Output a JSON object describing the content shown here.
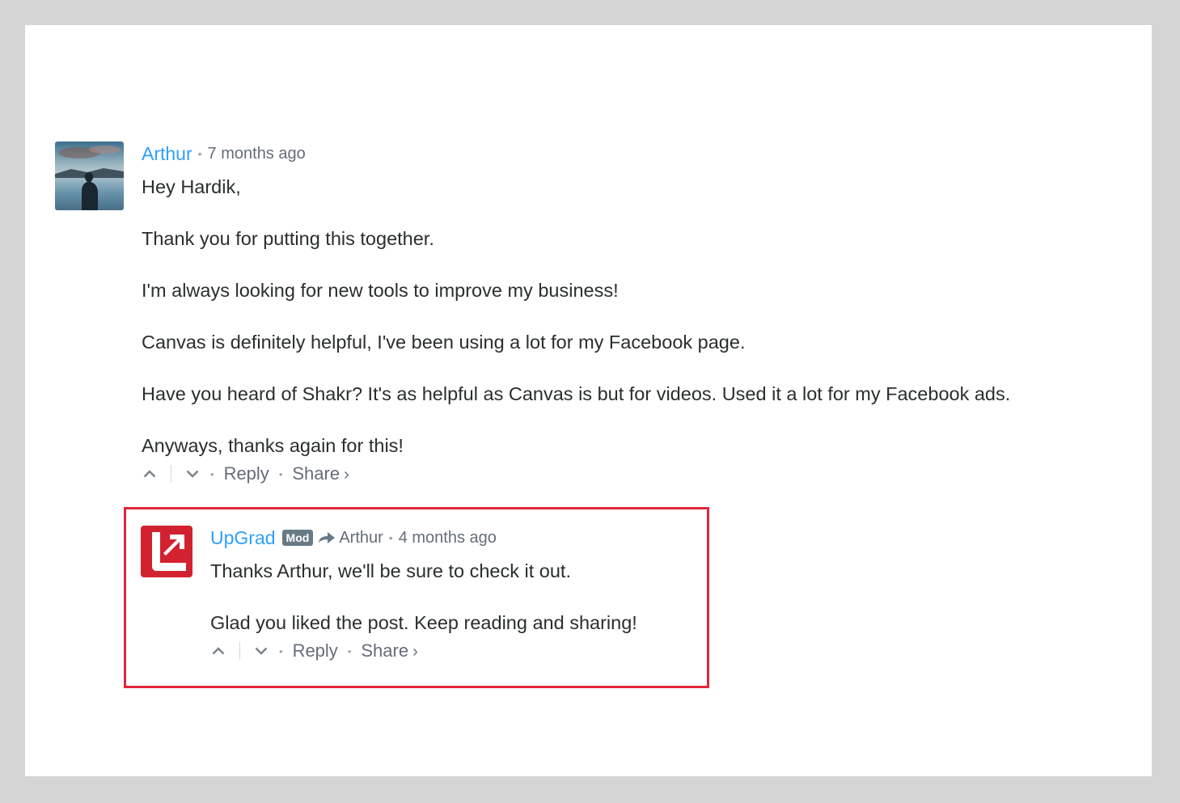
{
  "comments": [
    {
      "author": "Arthur",
      "time": "7 months ago",
      "paragraphs": [
        "Hey Hardik,",
        "Thank you for putting this together.",
        "I'm always looking for new tools to improve my business!",
        "Canvas is definitely helpful, I've been using a lot for my Facebook page.",
        "Have you heard of Shakr? It's as helpful as Canvas is but for videos. Used it a lot for my Facebook ads.",
        "Anyways, thanks again for this!"
      ],
      "reply_label": "Reply",
      "share_label": "Share",
      "share_chevron": "›"
    },
    {
      "author": "UpGrad",
      "badge": "Mod",
      "in_reply_to": "Arthur",
      "time": "4 months ago",
      "paragraphs": [
        "Thanks Arthur, we'll be sure to check it out.",
        "Glad you liked the post. Keep reading and sharing!"
      ],
      "reply_label": "Reply",
      "share_label": "Share",
      "share_chevron": "›"
    }
  ],
  "colors": {
    "author_link": "#2e9fff",
    "highlight_border": "#e0263b",
    "upgrad_brand": "#d3222f",
    "mod_badge": "#687a86"
  },
  "icons": {
    "upvote": "chevron-up-icon",
    "downvote": "chevron-down-icon",
    "reply_to": "reply-arrow-icon"
  }
}
